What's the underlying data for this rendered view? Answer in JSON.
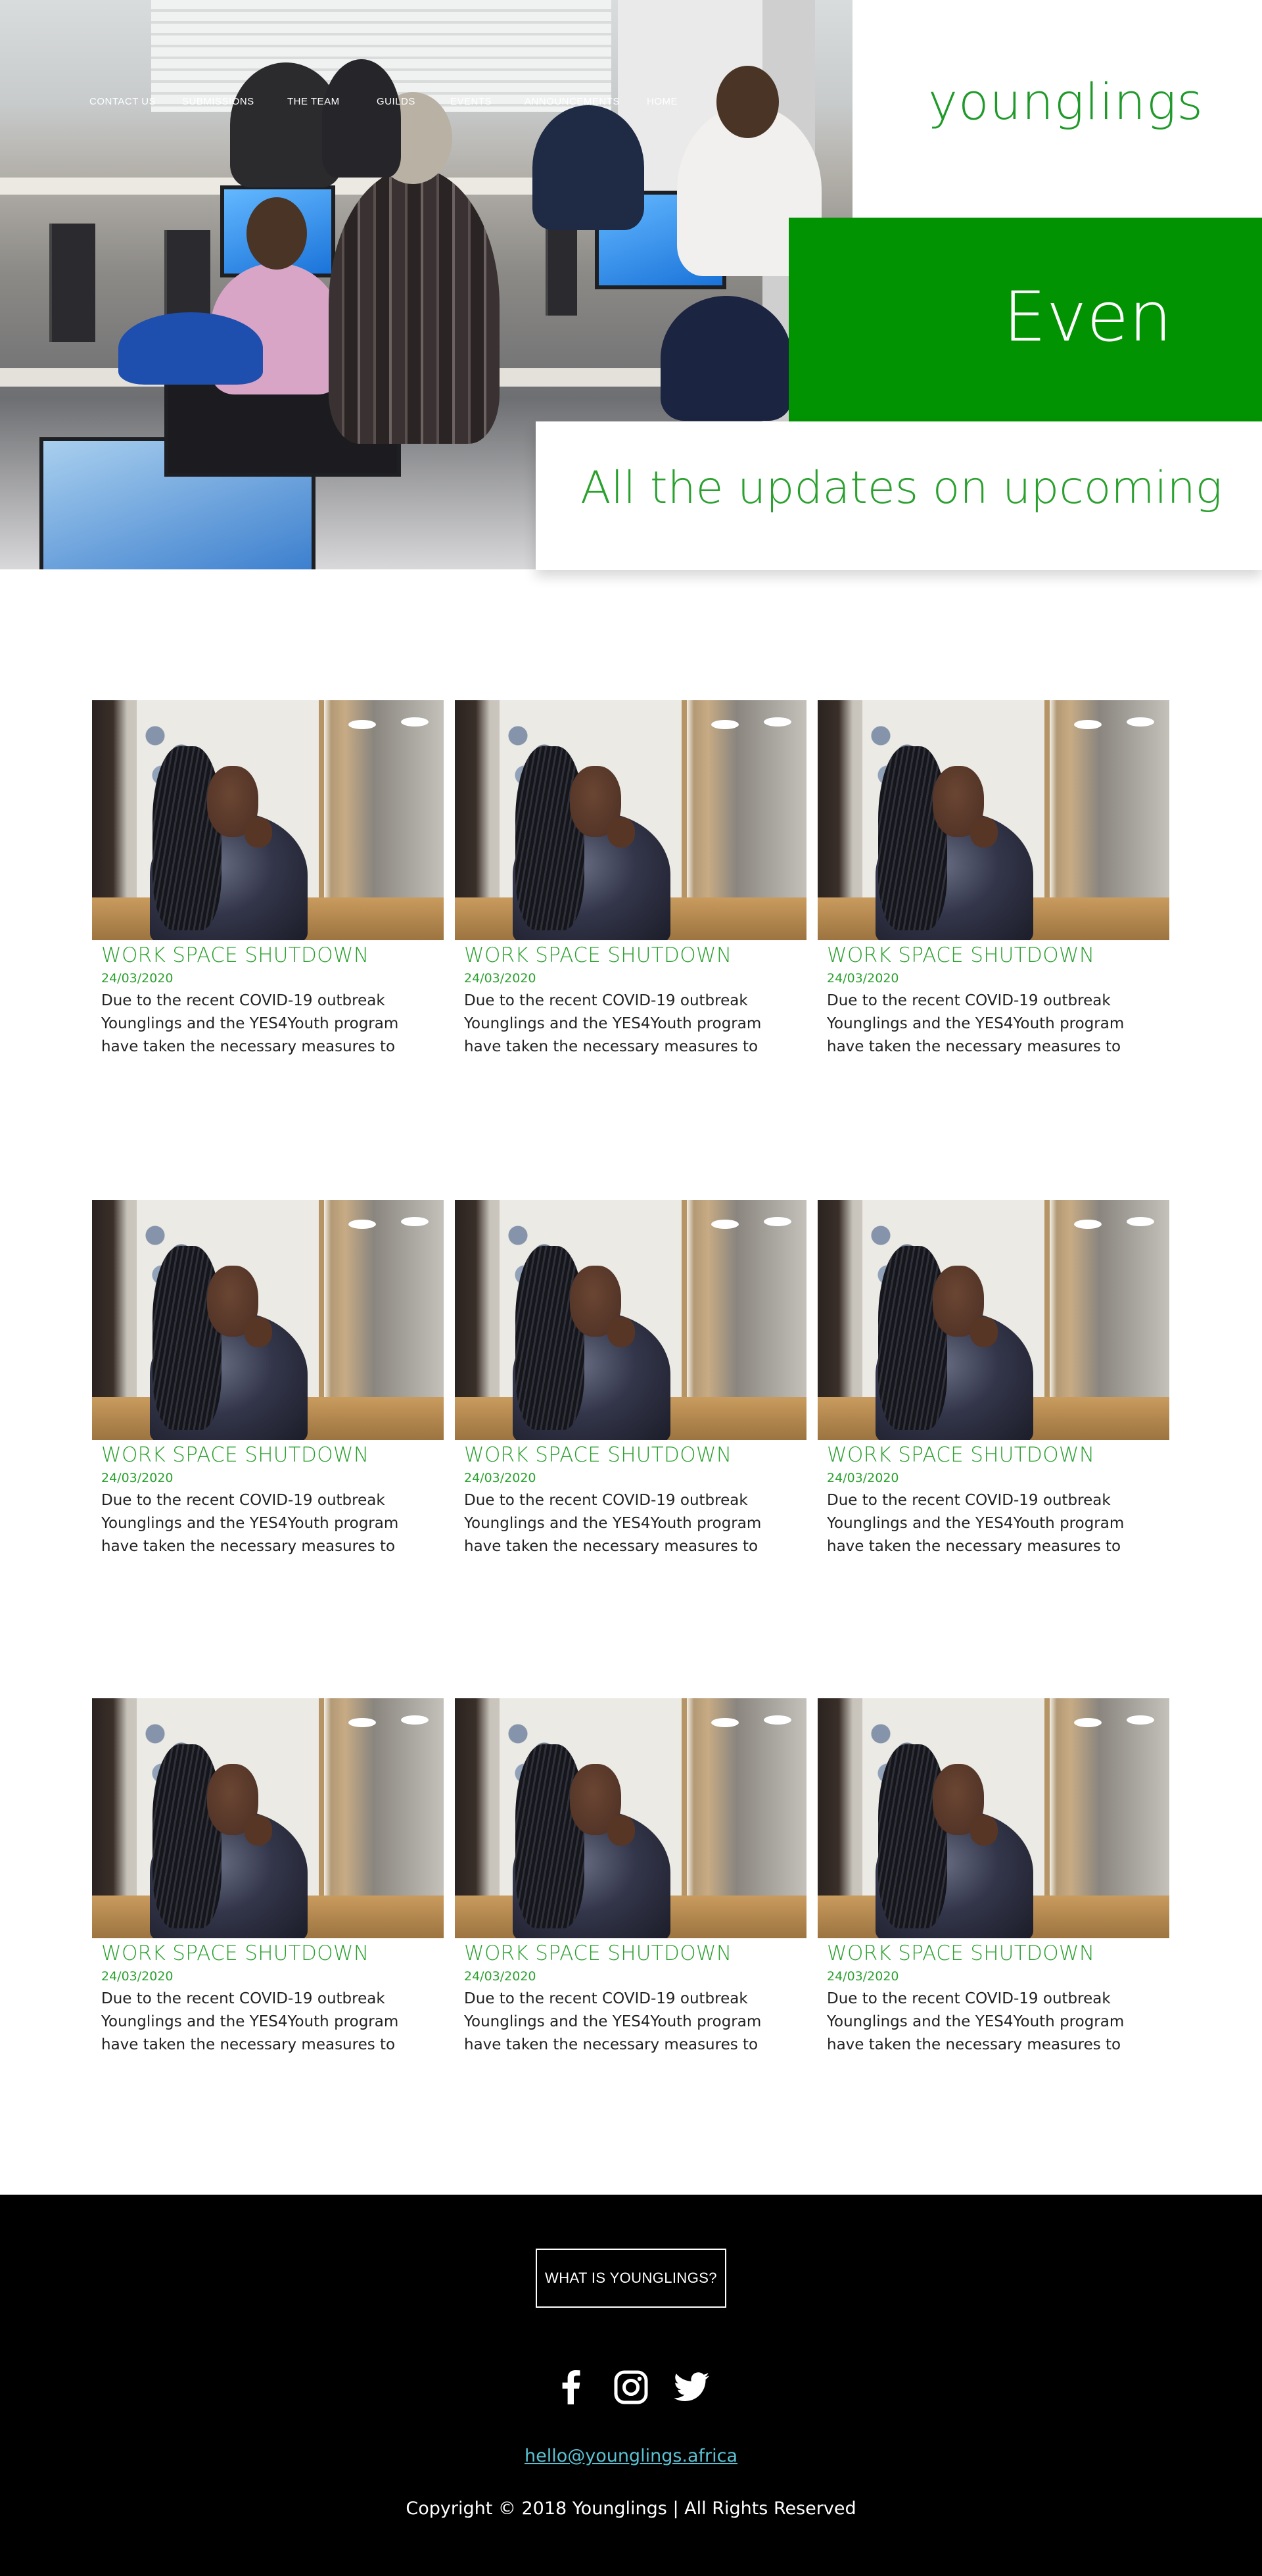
{
  "nav": {
    "items": [
      {
        "label": "Contact us"
      },
      {
        "label": "Submissions"
      },
      {
        "label": "The Team"
      },
      {
        "label": "Guilds"
      },
      {
        "label": "Events"
      },
      {
        "label": "Announcements"
      },
      {
        "label": "Home"
      }
    ]
  },
  "brand": {
    "name": "younglings"
  },
  "hero": {
    "headline": "Even",
    "subheading": "All the updates on upcoming"
  },
  "articles": [
    {
      "title": "WORK SPACE SHUTDOWN",
      "date": "24/03/2020",
      "excerpt": "Due to the recent COVID-19 outbreak Younglings and the YES4Youth program have taken the necessary measures to"
    },
    {
      "title": "WORK SPACE SHUTDOWN",
      "date": "24/03/2020",
      "excerpt": "Due to the recent COVID-19 outbreak Younglings and the YES4Youth program have taken the necessary measures to"
    },
    {
      "title": "WORK SPACE SHUTDOWN",
      "date": "24/03/2020",
      "excerpt": "Due to the recent COVID-19 outbreak Younglings and the YES4Youth program have taken the necessary measures to"
    },
    {
      "title": "WORK SPACE SHUTDOWN",
      "date": "24/03/2020",
      "excerpt": "Due to the recent COVID-19 outbreak Younglings and the YES4Youth program have taken the necessary measures to"
    },
    {
      "title": "WORK SPACE SHUTDOWN",
      "date": "24/03/2020",
      "excerpt": "Due to the recent COVID-19 outbreak Younglings and the YES4Youth program have taken the necessary measures to"
    },
    {
      "title": "WORK SPACE SHUTDOWN",
      "date": "24/03/2020",
      "excerpt": "Due to the recent COVID-19 outbreak Younglings and the YES4Youth program have taken the necessary measures to"
    },
    {
      "title": "WORK SPACE SHUTDOWN",
      "date": "24/03/2020",
      "excerpt": "Due to the recent COVID-19 outbreak Younglings and the YES4Youth program have taken the necessary measures to"
    },
    {
      "title": "WORK SPACE SHUTDOWN",
      "date": "24/03/2020",
      "excerpt": "Due to the recent COVID-19 outbreak Younglings and the YES4Youth program have taken the necessary measures to"
    },
    {
      "title": "WORK SPACE SHUTDOWN",
      "date": "24/03/2020",
      "excerpt": "Due to the recent COVID-19 outbreak Younglings and the YES4Youth program have taken the necessary measures to"
    }
  ],
  "footer": {
    "cta_label": "WHAT IS YOUNGLINGS?",
    "social_icons": [
      "facebook-icon",
      "instagram-icon",
      "twitter-icon"
    ],
    "email": "hello@younglings.africa",
    "copyright": "Copyright © 2018 Younglings | All Rights Reserved"
  },
  "colors": {
    "brand_green": "#029302",
    "text_green": "#2aa02e",
    "footer_bg": "#000000",
    "link_cyan": "#5bc1d2"
  }
}
